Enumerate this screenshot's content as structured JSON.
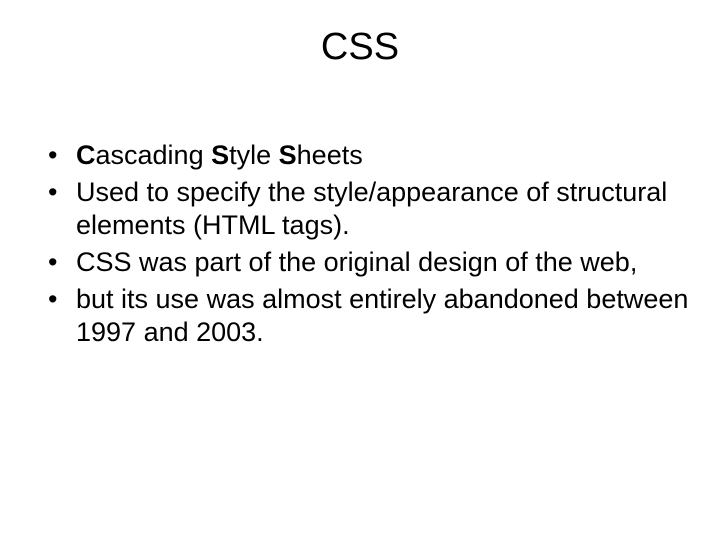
{
  "title": "CSS",
  "bullets": [
    {
      "b1": "C",
      "t1": "ascading ",
      "b2": "S",
      "t2": "tyle ",
      "b3": "S",
      "t3": "heets"
    },
    {
      "text": "Used to specify the style/appearance of structural elements (HTML tags)."
    },
    {
      "text": "CSS was part of the original design of the web,"
    },
    {
      "text": "but its use was almost entirely abandoned between 1997 and 2003."
    }
  ]
}
